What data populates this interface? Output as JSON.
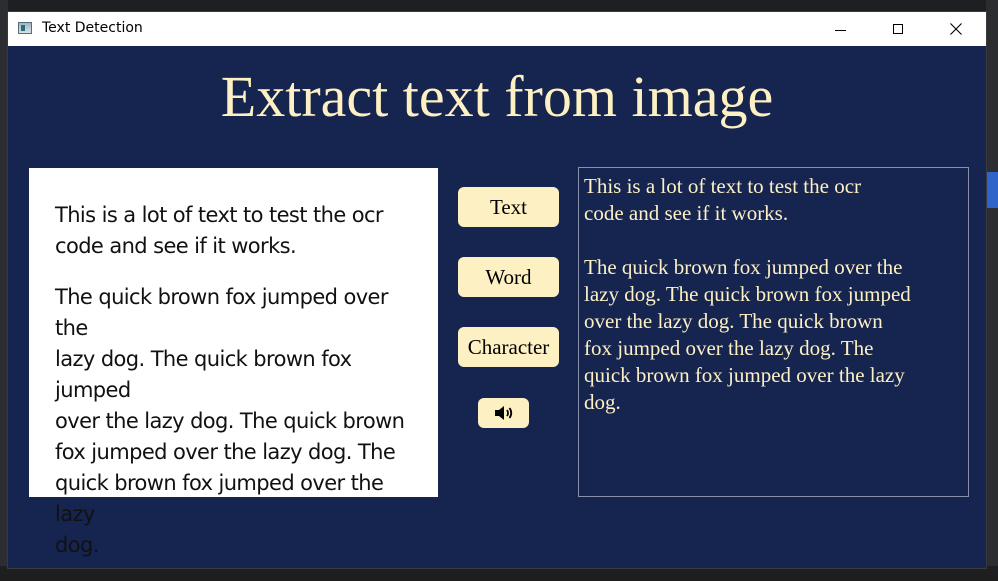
{
  "window": {
    "title": "Text Detection"
  },
  "heading": "Extract text from image",
  "image_panel": {
    "paragraph_1": "This is a lot of text to test the ocr\ncode and see if it works.",
    "paragraph_2": "The quick brown fox jumped over the\nlazy dog. The quick brown fox jumped\nover the lazy dog. The quick brown\nfox jumped over the lazy dog. The\nquick brown fox jumped over the lazy\ndog."
  },
  "buttons": {
    "text": "Text",
    "word": "Word",
    "character": "Character",
    "speak_icon": "speaker-icon"
  },
  "output": {
    "text": "This is a lot of text to test the ocr\ncode and see if it works.\n\nThe quick brown fox jumped over the\nlazy dog. The quick brown fox jumped\nover the lazy dog. The quick brown\nfox jumped over the lazy dog. The\nquick brown fox jumped over the lazy\ndog."
  },
  "colors": {
    "background": "#162450",
    "accent": "#fdf0c2"
  }
}
